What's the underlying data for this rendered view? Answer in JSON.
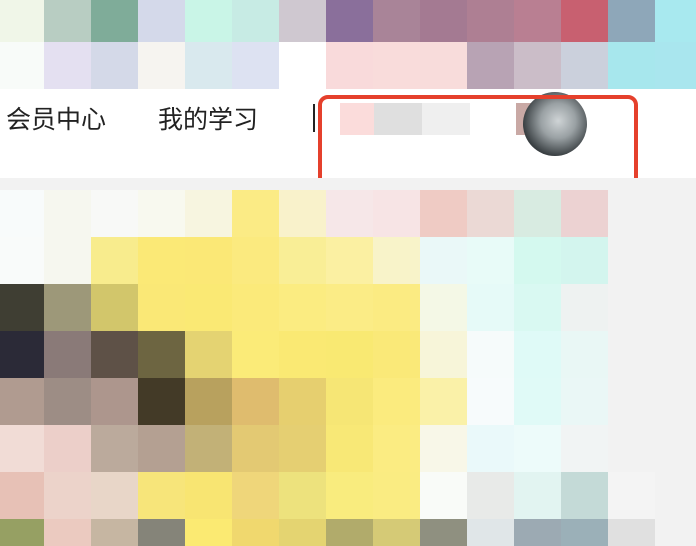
{
  "nav": {
    "member_center": "会员中心",
    "my_learning": "我的学习"
  },
  "annotation": {
    "highlight_color": "#e5402c"
  },
  "pixelated_banner_colors": [
    [
      "#f0f6e8",
      "#b8cdc2",
      "#7fac99",
      "#d4d9ea",
      "#c9f5e7",
      "#c7ebe4",
      "#cfc8d0",
      "#8a6f9b",
      "#a98498",
      "#a47a92",
      "#ae7f93",
      "#b97f92",
      "#c86070",
      "#8ea7b9",
      "#a8e9ef"
    ],
    [
      "#f8fbf9",
      "#e4e0f1",
      "#d4d9e8",
      "#f6f4f0",
      "#d9e9ee",
      "#dde2f2",
      "#ffffff",
      "#f9dadb",
      "#f9dcdb",
      "#f8dcdb",
      "#b8a3b4",
      "#cbbdc8",
      "#cbd0dc",
      "#a7e7ed",
      "#a9e6ee"
    ]
  ],
  "blurred_account_colors": [
    "#fbdcdb",
    "#dfdfdf",
    "#efefef",
    "#ffffff",
    "#c9a9a5"
  ],
  "pixelated_content_colors": [
    [
      "#f8fbfb",
      "#f6f7ef",
      "#f8f9f7",
      "#f8f9ef",
      "#f7f5e0",
      "#fbeb85",
      "#f9f2cb",
      "#f6e7e8",
      "#f7e4e5",
      "#efcbc4",
      "#ebd9d5",
      "#d8ebe1",
      "#ecd2d2",
      "#f2f2f2",
      "#f2f2f2"
    ],
    [
      "#f9fbfa",
      "#f6f7ef",
      "#f8ec8d",
      "#fbe976",
      "#fbe876",
      "#fbea7f",
      "#f9ee96",
      "#fbf0a2",
      "#f8f3c9",
      "#eaf8f8",
      "#e8fbf8",
      "#d4f9ef",
      "#d3f5ee",
      "#f2f2f2",
      "#f2f2f2"
    ],
    [
      "#3f3e33",
      "#9d9879",
      "#d2c66b",
      "#fae876",
      "#fae974",
      "#fbea7a",
      "#fbec81",
      "#fbec86",
      "#fbeb82",
      "#f4f8e6",
      "#e6faf8",
      "#d9f9f2",
      "#eef2f1",
      "#f2f2f2",
      "#f2f2f2"
    ],
    [
      "#2b2a37",
      "#8a7a78",
      "#5e5147",
      "#6d6541",
      "#e4d372",
      "#fbeb78",
      "#fae973",
      "#f9e972",
      "#fae978",
      "#f7f5d9",
      "#f6fbfb",
      "#dffaf7",
      "#e9f7f5",
      "#f2f2f2",
      "#f2f2f2"
    ],
    [
      "#b09b90",
      "#9d8d85",
      "#ad968d",
      "#433a27",
      "#b8a15e",
      "#dfbc6e",
      "#e6cf6f",
      "#f6e675",
      "#fbeb7e",
      "#faf1a8",
      "#f7fbfc",
      "#e0faf7",
      "#eaf7f6",
      "#f2f2f2",
      "#f2f2f2"
    ],
    [
      "#f1dcd6",
      "#eccfc9",
      "#bbaa9c",
      "#b4a092",
      "#c2b177",
      "#e3c973",
      "#e5cf72",
      "#f8e876",
      "#fbec82",
      "#f8f7e8",
      "#eaf9fa",
      "#edfbfa",
      "#f1f4f4",
      "#f2f2f2",
      "#f2f2f2"
    ],
    [
      "#e7c1b6",
      "#ecd3ca",
      "#e8d6c8",
      "#f7e57a",
      "#f8e572",
      "#efd67a",
      "#ede27d",
      "#f9ec7e",
      "#faec82",
      "#f9fbf8",
      "#e8eae8",
      "#e2f4f1",
      "#c4dad7",
      "#f4f4f4",
      "#f2f2f2"
    ],
    [
      "#96a063",
      "#ebcac0",
      "#c6b6a2",
      "#858479",
      "#fbea72",
      "#f0d86e",
      "#e4d471",
      "#b1ab6b",
      "#d5ca76",
      "#8f9080",
      "#e0e6e8",
      "#9caab3",
      "#9bb0b8",
      "#e0e0e0",
      "#f2f2f2"
    ]
  ]
}
